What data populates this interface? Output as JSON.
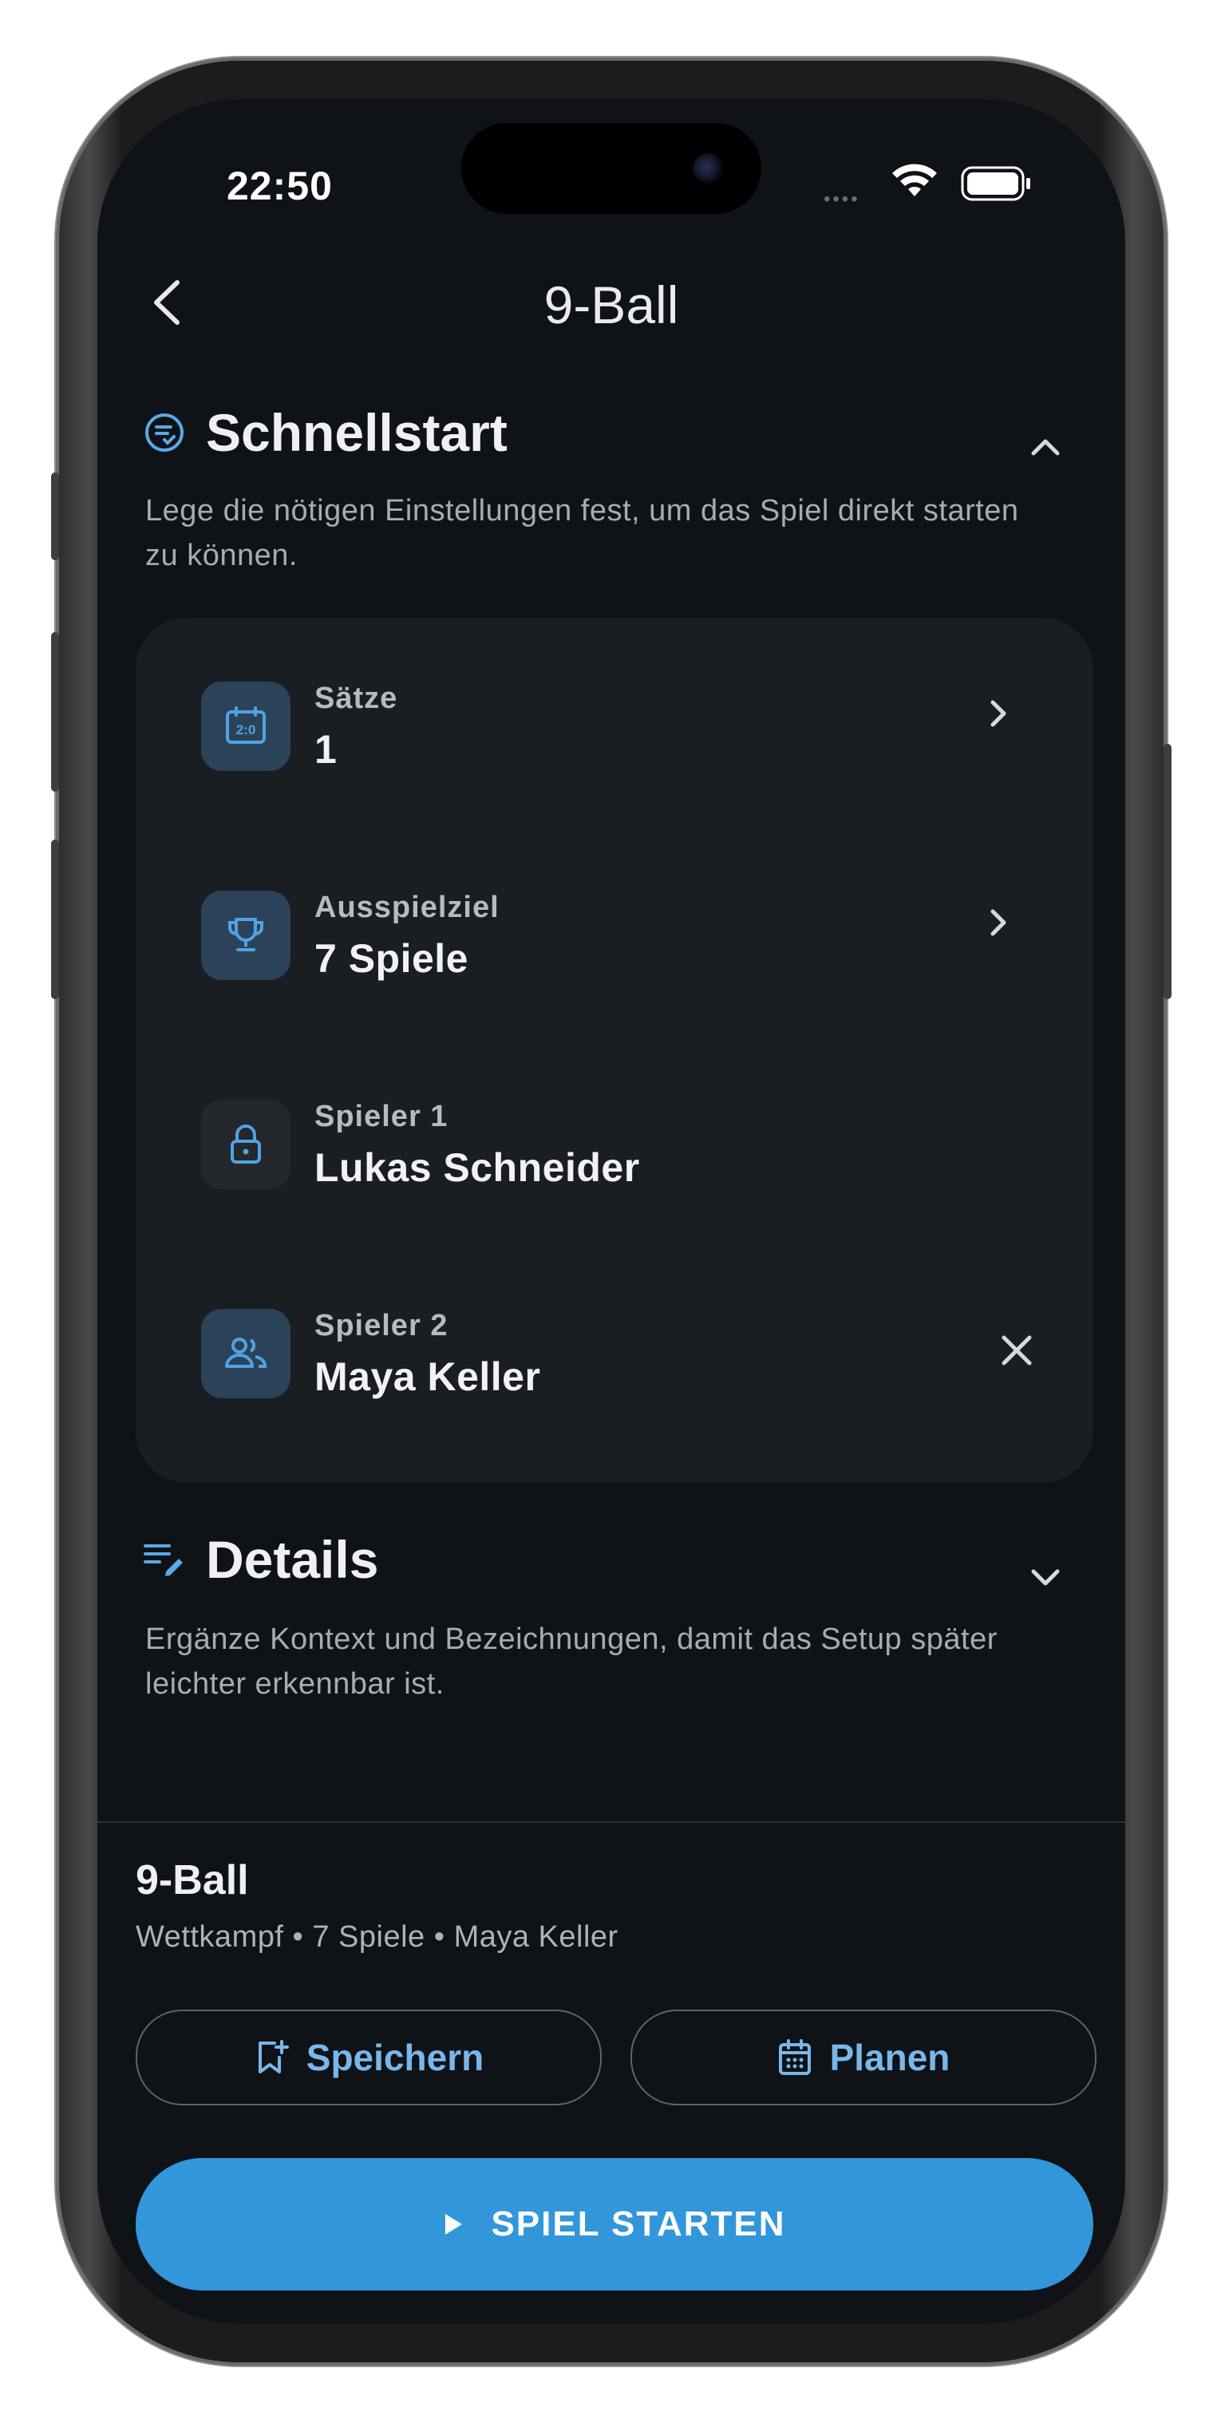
{
  "status_bar": {
    "time": "22:50",
    "signal": "••••"
  },
  "header": {
    "title": "9-Ball"
  },
  "quickstart": {
    "title": "Schnellstart",
    "description": "Lege die nötigen Einstellungen fest, um das Spiel direkt starten zu können.",
    "settings": [
      {
        "label": "Sätze",
        "value": "1",
        "icon": "scoreboard-icon"
      },
      {
        "label": "Ausspielziel",
        "value": "7 Spiele",
        "icon": "trophy-icon"
      },
      {
        "label": "Spieler 1",
        "value": "Lukas Schneider",
        "icon": "lock-icon"
      },
      {
        "label": "Spieler 2",
        "value": "Maya Keller",
        "icon": "people-icon"
      }
    ]
  },
  "details": {
    "title": "Details",
    "description": "Ergänze Kontext und Bezeichnungen, damit das Setup später leichter erkennbar ist."
  },
  "summary": {
    "title": "9-Ball",
    "subtitle": "Wettkampf • 7 Spiele • Maya Keller"
  },
  "actions": {
    "save_label": "Speichern",
    "plan_label": "Planen",
    "start_label": "SPIEL STARTEN"
  },
  "colors": {
    "accent": "#3296db",
    "background": "#0f1216",
    "card": "#1a1d22"
  }
}
